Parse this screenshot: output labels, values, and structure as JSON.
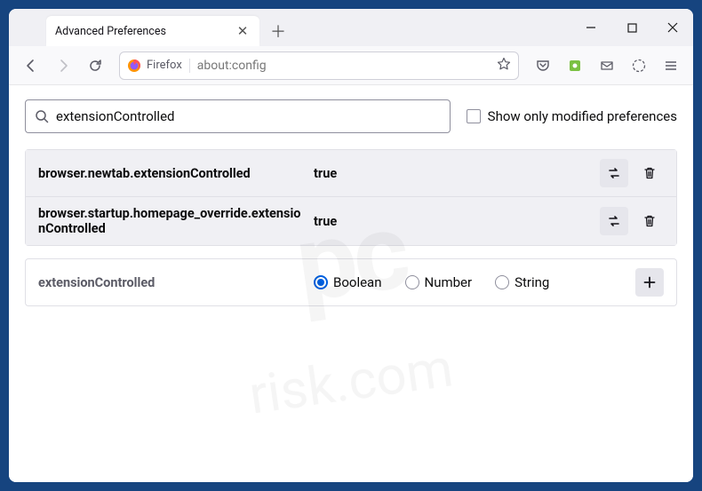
{
  "window": {
    "tab_title": "Advanced Preferences",
    "urlbar": {
      "identity_label": "Firefox",
      "url": "about:config"
    }
  },
  "search": {
    "value": "extensionControlled",
    "checkbox_label": "Show only modified preferences"
  },
  "prefs": [
    {
      "name": "browser.newtab.extensionControlled",
      "value": "true"
    },
    {
      "name": "browser.startup.homepage_override.extensionControlled",
      "value": "true"
    }
  ],
  "new_pref": {
    "name": "extensionControlled",
    "types": [
      "Boolean",
      "Number",
      "String"
    ],
    "selected": "Boolean"
  },
  "watermark": {
    "line1": "pc",
    "line2": "risk.com"
  }
}
